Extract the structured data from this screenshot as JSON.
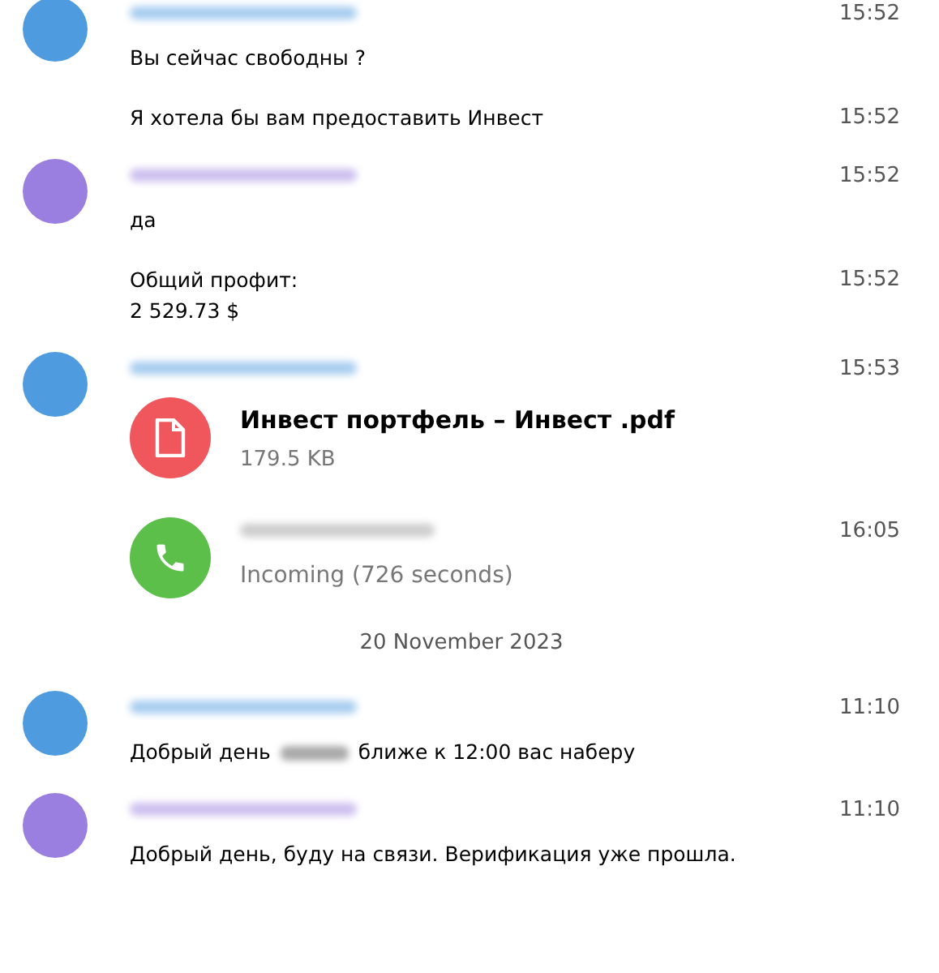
{
  "history": [
    {
      "kind": "group",
      "color": "#4f9be0",
      "time": "15:52",
      "messages": [
        {
          "kind": "text",
          "text": "Вы сейчас свободны ?"
        },
        {
          "kind": "text",
          "text": "Я хотела бы вам предоставить Инвест",
          "time": "15:52"
        }
      ]
    },
    {
      "kind": "group",
      "color": "#9b7fe0",
      "time": "15:52",
      "messages": [
        {
          "kind": "text",
          "text": "да"
        },
        {
          "kind": "text",
          "text": "Общий профит:\n2 529.73 $",
          "time": "15:52"
        }
      ]
    },
    {
      "kind": "group",
      "color": "#4f9be0",
      "time": "15:53",
      "messages": [
        {
          "kind": "file",
          "title": "Инвест портфель – Инвест .pdf",
          "size": "179.5 KB"
        },
        {
          "kind": "call",
          "status": "Incoming (726 seconds)",
          "time": "16:05"
        }
      ]
    },
    {
      "kind": "date",
      "text": "20 November 2023"
    },
    {
      "kind": "group",
      "color": "#4f9be0",
      "time": "11:10",
      "messages": [
        {
          "kind": "redacted",
          "before": "Добрый день",
          "after": "ближе к 12:00 вас наберу"
        }
      ]
    },
    {
      "kind": "group",
      "color": "#9b7fe0",
      "time": "11:10",
      "messages": [
        {
          "kind": "text",
          "text": "Добрый день, буду на связи. Верификация уже прошла."
        }
      ]
    }
  ]
}
